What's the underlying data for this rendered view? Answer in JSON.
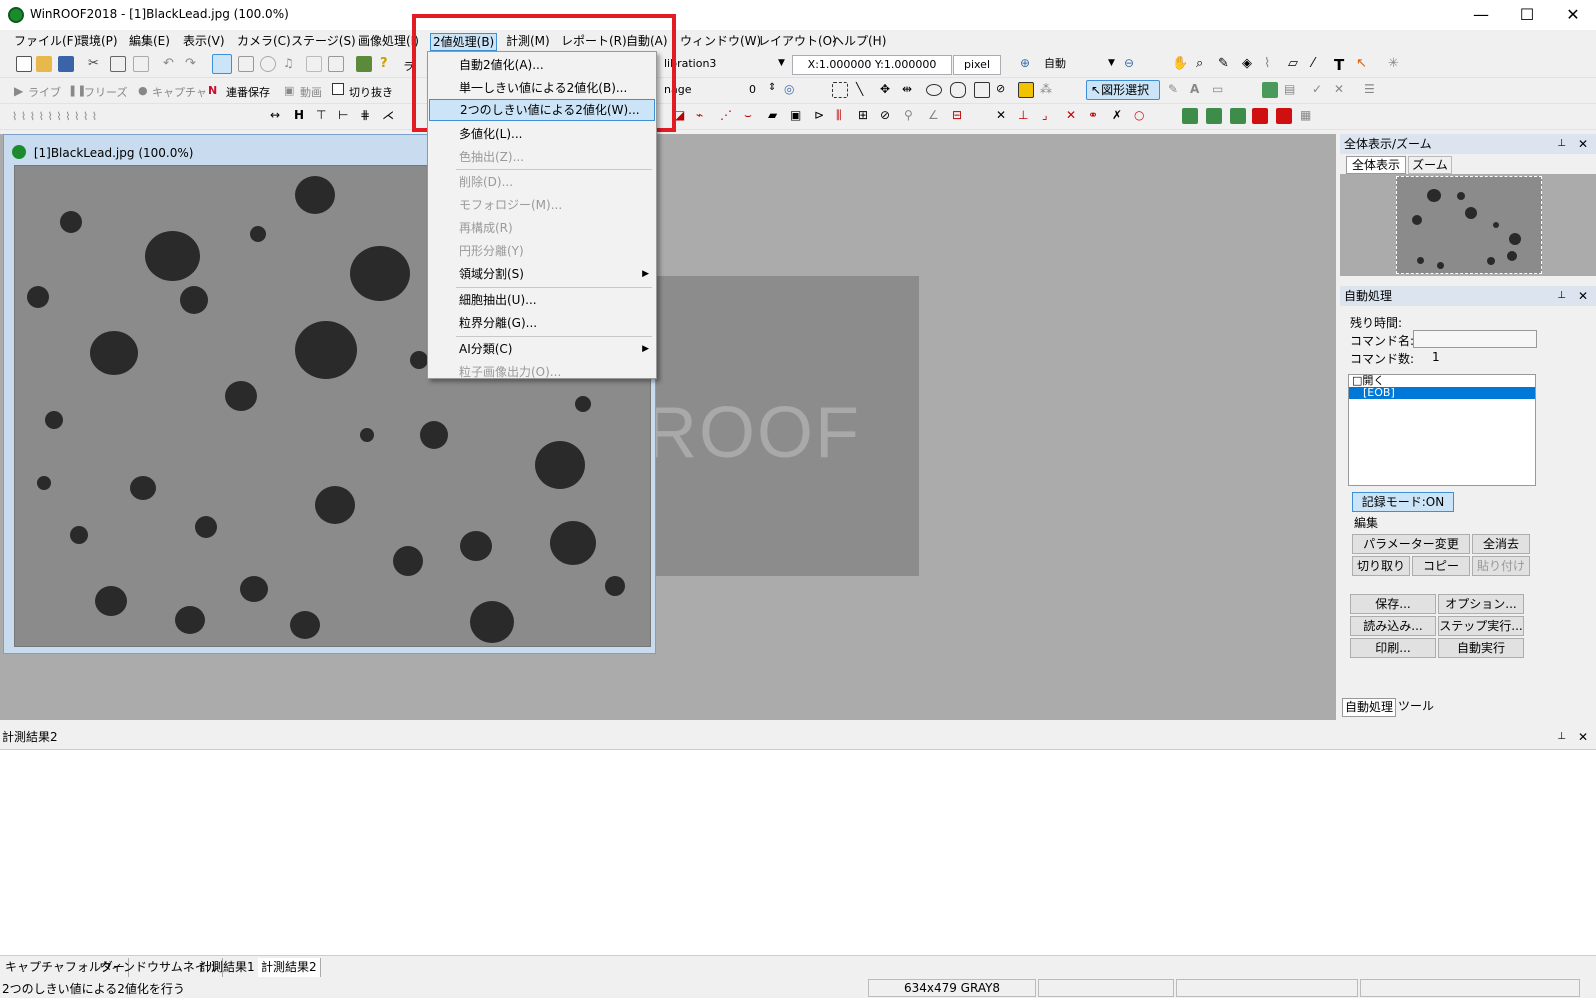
{
  "window": {
    "title": "WinROOF2018 - [1]BlackLead.jpg (100.0%)",
    "controls": {
      "minimize": "—",
      "maximize": "☐",
      "close": "✕"
    }
  },
  "menubar": [
    "ファイル(F)",
    "環境(P)",
    "編集(E)",
    "表示(V)",
    "カメラ(C)",
    "ステージ(S)",
    "画像処理(I)",
    "2値処理(B)",
    "計測(M)",
    "レポート(R)",
    "自動(A)",
    "ウィンドウ(W)",
    "レイアウト(O)",
    "ヘルプ(H)"
  ],
  "dropdown": {
    "items": [
      {
        "label": "自動2値化(A)...",
        "state": "enabled"
      },
      {
        "label": "単一しきい値による2値化(B)...",
        "state": "enabled"
      },
      {
        "label": "2つのしきい値による2値化(W)...",
        "state": "selected"
      },
      {
        "label": "多値化(L)...",
        "state": "enabled"
      },
      {
        "label": "色抽出(Z)...",
        "state": "disabled"
      },
      {
        "label": "削除(D)...",
        "state": "disabled"
      },
      {
        "label": "モフォロジー(M)...",
        "state": "disabled"
      },
      {
        "label": "再構成(R)",
        "state": "disabled"
      },
      {
        "label": "円形分離(Y)",
        "state": "disabled"
      },
      {
        "label": "領域分割(S)",
        "state": "enabled",
        "submenu": true
      },
      {
        "label": "細胞抽出(U)...",
        "state": "enabled"
      },
      {
        "label": "粒界分離(G)...",
        "state": "enabled"
      },
      {
        "label": "AI分類(C)",
        "state": "enabled",
        "submenu": true
      },
      {
        "label": "粒子画像出力(O)...",
        "state": "disabled"
      }
    ]
  },
  "toolbar1": {
    "calibration": "libration3",
    "scale": "X:1.000000 Y:1.000000",
    "unit": "pixel",
    "zoom_mode": "自動",
    "partial_text": "ラ"
  },
  "toolbar2": {
    "live": "ライブ",
    "freeze": "フリーズ",
    "capture": "キャプチャ",
    "serial_save": "連番保存",
    "video": "動画",
    "crop": "切り抜き",
    "image_field": "nage",
    "count_value": "0",
    "shape_select": "図形選択"
  },
  "image_window": {
    "title": "[1]BlackLead.jpg (100.0%)",
    "bg_color": "#8b8b8b"
  },
  "workspace": {
    "logo": "ROOF"
  },
  "overview_panel": {
    "title": "全体表示/ズーム",
    "tabs": [
      "全体表示",
      "ズーム"
    ]
  },
  "auto_panel": {
    "title": "自動処理",
    "remaining_time_label": "残り時間:",
    "command_name_label": "コマンド名:",
    "command_count_label": "コマンド数:",
    "command_count": "1",
    "list_items": [
      "□開く",
      "　[EOB]"
    ],
    "record_mode": "記録モード:ON",
    "edit_label": "編集",
    "buttons": {
      "param_change": "パラメーター変更",
      "clear_all": "全消去",
      "cut": "切り取り",
      "copy": "コピー",
      "paste": "貼り付け",
      "save": "保存...",
      "option": "オプション...",
      "load": "読み込み...",
      "step_run": "ステップ実行...",
      "print": "印刷...",
      "auto_run": "自動実行"
    },
    "bottom_tabs": [
      "自動処理",
      "ツール"
    ]
  },
  "results": {
    "title": "計測結果2"
  },
  "bottom_tabs": [
    "キャプチャフォルダー",
    "ウィンドウサムネイル",
    "計測結果1",
    "計測結果2"
  ],
  "status": {
    "message": "2つのしきい値による2値化を行う",
    "image_info": "634x479 GRAY8"
  },
  "colors": {
    "highlight_box": "#e31b23",
    "selected_item": "#cce4f7",
    "list_selection": "#0078d7"
  }
}
